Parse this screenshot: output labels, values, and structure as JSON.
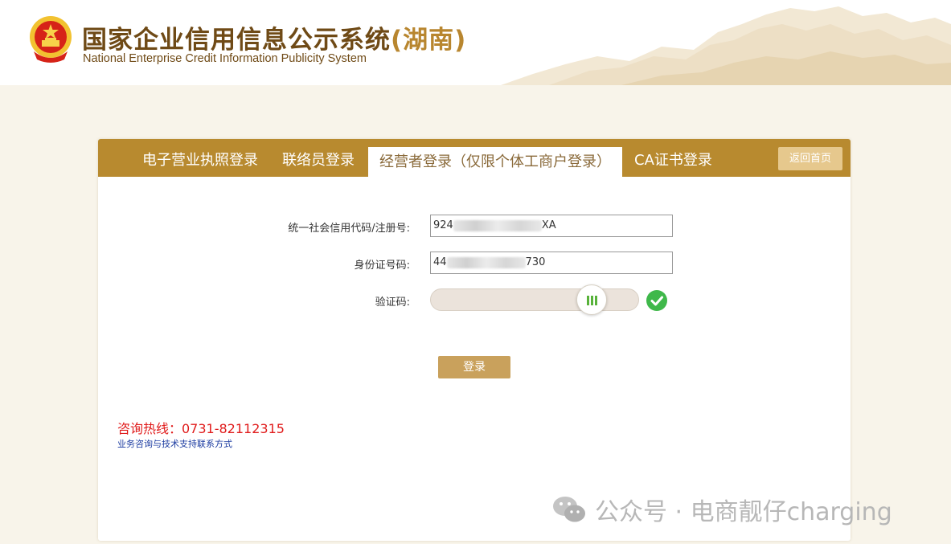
{
  "header": {
    "title_cn": "国家企业信用信息公示系统",
    "title_province": "(湖南)",
    "title_en": "National Enterprise Credit Information Publicity System"
  },
  "tabs": [
    {
      "label": "电子营业执照登录",
      "active": false
    },
    {
      "label": "联络员登录",
      "active": false
    },
    {
      "label": "经营者登录（仅限个体工商户登录）",
      "active": true
    },
    {
      "label": "CA证书登录",
      "active": false
    }
  ],
  "home_button": "返回首页",
  "form": {
    "credit_code_label": "统一社会信用代码/注册号:",
    "credit_code_prefix": "924",
    "credit_code_suffix": "XA",
    "id_label": "身份证号码:",
    "id_prefix": "44",
    "id_suffix": "730",
    "captcha_label": "验证码:",
    "login_button": "登录"
  },
  "footer": {
    "hotline": "咨询热线：0731-82112315",
    "support_link": "业务咨询与技术支持联系方式"
  },
  "watermark": "公众号 · 电商靓仔charging",
  "colors": {
    "accent": "#b88a2f",
    "login_button": "#c9a15c",
    "success": "#3fb84a",
    "hotline": "#e01b1b"
  }
}
